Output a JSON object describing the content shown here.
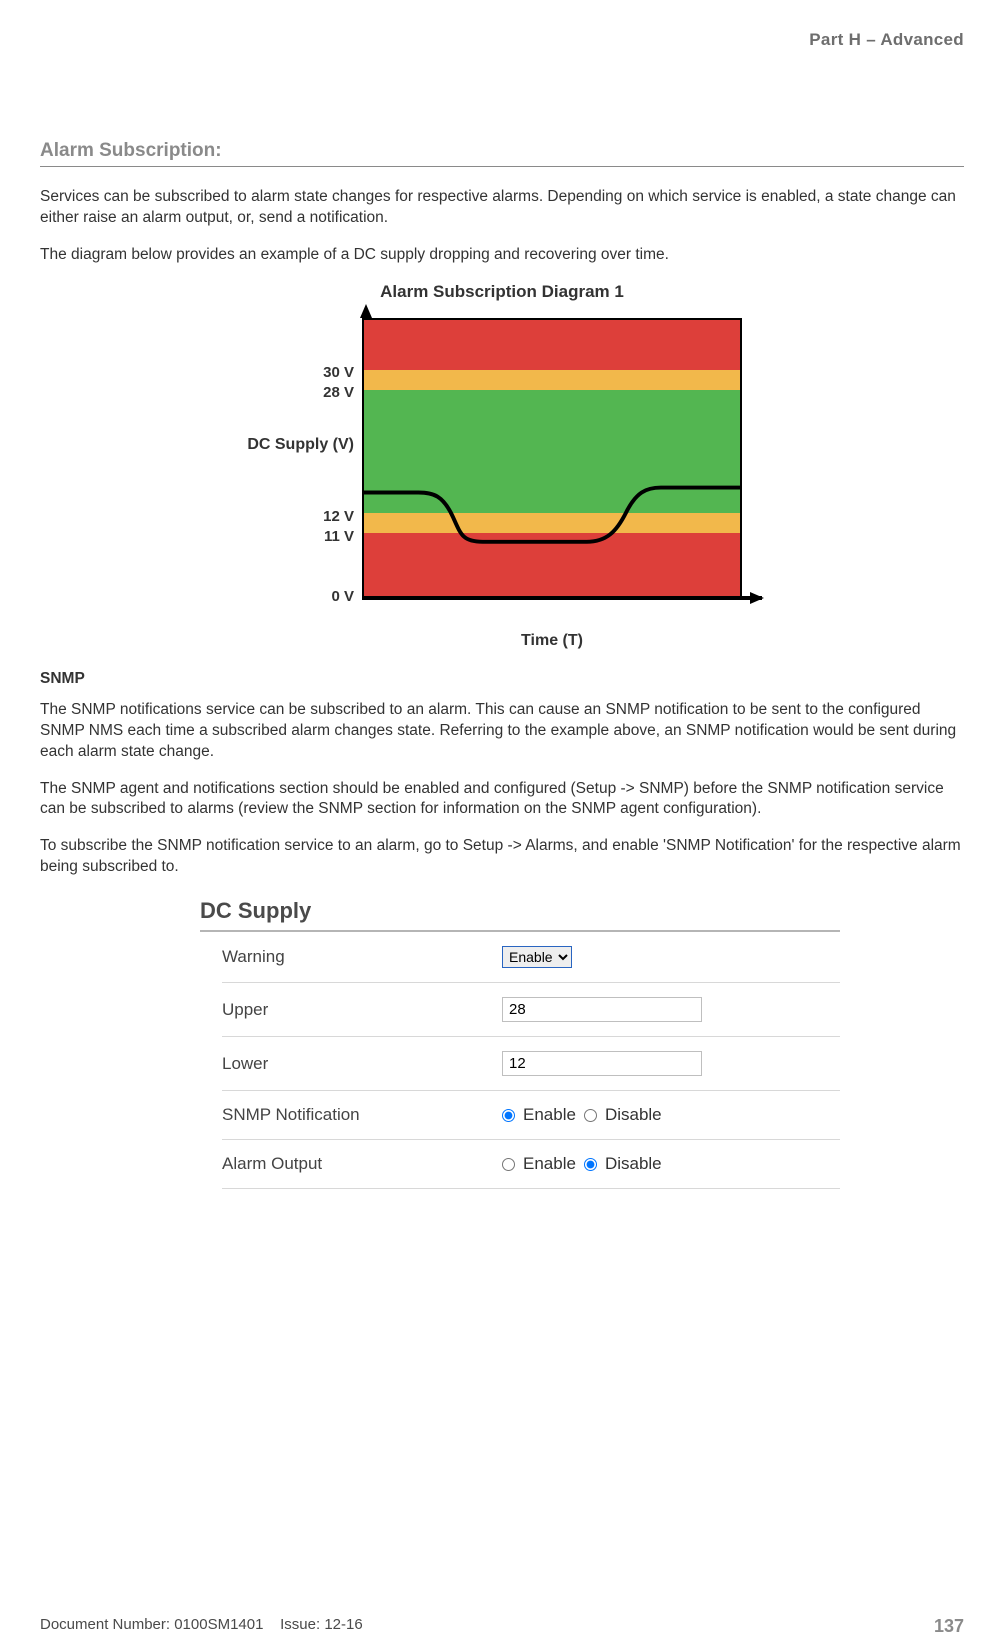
{
  "part_header": "Part H – Advanced",
  "section_title": "Alarm Subscription:",
  "para1": "Services can be subscribed to alarm state changes for respective alarms. Depending on which service is enabled, a state change can either raise an alarm output, or, send a notification.",
  "para2": "The diagram below provides an example of a DC supply dropping and recovering over time.",
  "diagram": {
    "title": "Alarm Subscription Diagram 1",
    "y_axis_label": "DC Supply (V)",
    "x_axis_label": "Time (T)",
    "ticks": {
      "v30": "30 V",
      "v28": "28 V",
      "v12": "12 V",
      "v11": "11 V",
      "v0": "0 V"
    }
  },
  "snmp_heading": "SNMP",
  "snmp_p1": "The SNMP notifications service can be subscribed to an alarm. This can cause an SNMP notification to be sent to the configured SNMP NMS each time a subscribed alarm changes state. Referring to the example above, an SNMP notification would be sent during each alarm state change.",
  "snmp_p2": "The SNMP agent and notifications section should be enabled and configured (Setup -> SNMP) before the SNMP notification service can be subscribed to alarms (review the SNMP section for information on the SNMP agent configuration).",
  "snmp_p3": "To subscribe the SNMP notification service to an alarm, go to Setup -> Alarms, and enable 'SNMP Notification' for the respective alarm being subscribed to.",
  "form": {
    "header": "DC Supply",
    "rows": {
      "warning": {
        "label": "Warning",
        "value": "Enable"
      },
      "upper": {
        "label": "Upper",
        "value": "28"
      },
      "lower": {
        "label": "Lower",
        "value": "12"
      },
      "snmp": {
        "label": "SNMP Notification",
        "enable": "Enable",
        "disable": "Disable",
        "selected": "enable"
      },
      "alarmout": {
        "label": "Alarm Output",
        "enable": "Enable",
        "disable": "Disable",
        "selected": "disable"
      }
    }
  },
  "footer": {
    "docnum": "Document Number: 0100SM1401",
    "issue": "Issue: 12-16",
    "page": "137"
  },
  "chart_data": {
    "type": "line",
    "title": "Alarm Subscription Diagram 1",
    "xlabel": "Time (T)",
    "ylabel": "DC Supply (V)",
    "ylim": [
      0,
      36
    ],
    "bands": [
      {
        "from": 30,
        "to": 36,
        "color": "#dd3f3a",
        "meaning": "alarm-high"
      },
      {
        "from": 28,
        "to": 30,
        "color": "#f2b84b",
        "meaning": "warning-high"
      },
      {
        "from": 12,
        "to": 28,
        "color": "#53b651",
        "meaning": "normal"
      },
      {
        "from": 11,
        "to": 12,
        "color": "#f2b84b",
        "meaning": "warning-low"
      },
      {
        "from": 0,
        "to": 11,
        "color": "#dd3f3a",
        "meaning": "alarm-low"
      }
    ],
    "x": [
      0,
      15,
      22,
      35,
      60,
      70,
      80,
      100
    ],
    "values": [
      14,
      14,
      11,
      10.5,
      10.5,
      13,
      14,
      14
    ],
    "y_ticks": [
      0,
      11,
      12,
      28,
      30
    ]
  }
}
